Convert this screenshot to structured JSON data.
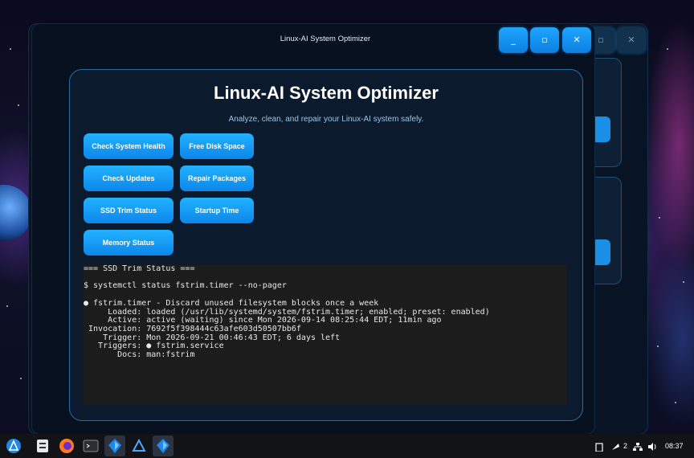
{
  "window": {
    "title": "Linux-AI System Optimizer",
    "controls": {
      "minimize": "_",
      "maximize": "▫",
      "close": "✕"
    }
  },
  "app": {
    "heading": "Linux-AI System Optimizer",
    "subtitle": "Analyze, clean, and repair your Linux-AI system safely.",
    "buttons": [
      "Check System Health",
      "Free Disk Space",
      "Check Updates",
      "Repair Packages",
      "SSD Trim Status",
      "Startup Time",
      "Memory Status"
    ]
  },
  "output": {
    "lines": [
      "=== SSD Trim Status ===",
      "",
      "$ systemctl status fstrim.timer --no-pager",
      "",
      "● fstrim.timer - Discard unused filesystem blocks once a week",
      "     Loaded: loaded (/usr/lib/systemd/system/fstrim.timer; enabled; preset: enabled)",
      "     Active: active (waiting) since Mon 2026-09-14 08:25:44 EDT; 11min ago",
      " Invocation: 7692f5f398444c63afe603d50507bb6f",
      "    Trigger: Mon 2026-09-21 00:46:43 EDT; 6 days left",
      "   Triggers: ● fstrim.service",
      "       Docs: man:fstrim"
    ]
  },
  "taskbar": {
    "icons": [
      "start-menu-icon",
      "file-manager-icon",
      "firefox-icon",
      "terminal-icon",
      "optimizer-app-icon",
      "linux-ai-app-icon",
      "optimizer-app-active-icon"
    ],
    "notifications_count": "2",
    "clock": "08:37"
  },
  "colors": {
    "accent": "#1aa0ff",
    "card_border": "#2b6ba1",
    "terminal_bg": "#1c1c1c"
  }
}
